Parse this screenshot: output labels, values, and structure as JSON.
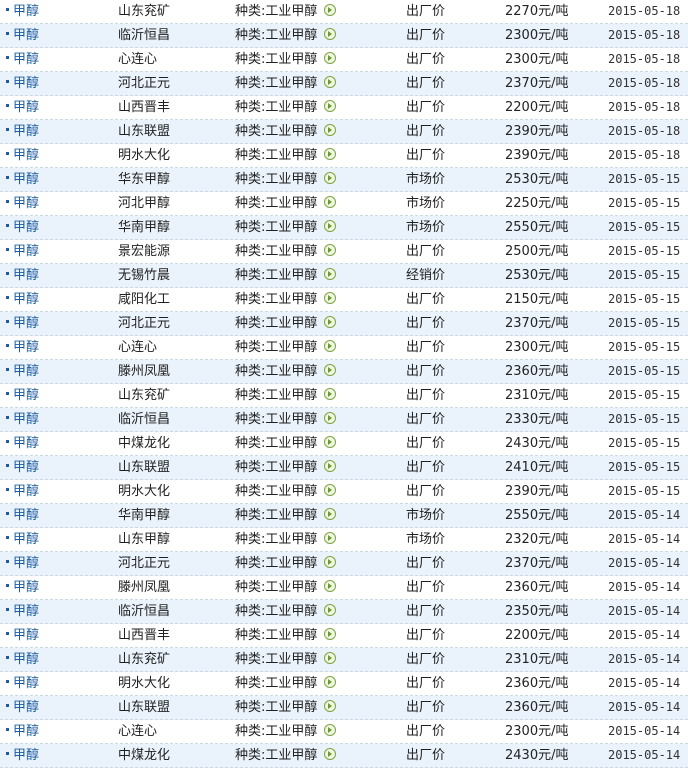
{
  "rows": [
    {
      "product": "甲醇",
      "company": "山东兖矿",
      "category": "种类:工业甲醇",
      "price_type": "出厂价",
      "price": "2270元/吨",
      "date": "2015-05-18"
    },
    {
      "product": "甲醇",
      "company": "临沂恒昌",
      "category": "种类:工业甲醇",
      "price_type": "出厂价",
      "price": "2300元/吨",
      "date": "2015-05-18"
    },
    {
      "product": "甲醇",
      "company": "心连心",
      "category": "种类:工业甲醇",
      "price_type": "出厂价",
      "price": "2300元/吨",
      "date": "2015-05-18"
    },
    {
      "product": "甲醇",
      "company": "河北正元",
      "category": "种类:工业甲醇",
      "price_type": "出厂价",
      "price": "2370元/吨",
      "date": "2015-05-18"
    },
    {
      "product": "甲醇",
      "company": "山西晋丰",
      "category": "种类:工业甲醇",
      "price_type": "出厂价",
      "price": "2200元/吨",
      "date": "2015-05-18"
    },
    {
      "product": "甲醇",
      "company": "山东联盟",
      "category": "种类:工业甲醇",
      "price_type": "出厂价",
      "price": "2390元/吨",
      "date": "2015-05-18"
    },
    {
      "product": "甲醇",
      "company": "明水大化",
      "category": "种类:工业甲醇",
      "price_type": "出厂价",
      "price": "2390元/吨",
      "date": "2015-05-18"
    },
    {
      "product": "甲醇",
      "company": "华东甲醇",
      "category": "种类:工业甲醇",
      "price_type": "市场价",
      "price": "2530元/吨",
      "date": "2015-05-15"
    },
    {
      "product": "甲醇",
      "company": "河北甲醇",
      "category": "种类:工业甲醇",
      "price_type": "市场价",
      "price": "2250元/吨",
      "date": "2015-05-15"
    },
    {
      "product": "甲醇",
      "company": "华南甲醇",
      "category": "种类:工业甲醇",
      "price_type": "市场价",
      "price": "2550元/吨",
      "date": "2015-05-15"
    },
    {
      "product": "甲醇",
      "company": "景宏能源",
      "category": "种类:工业甲醇",
      "price_type": "出厂价",
      "price": "2500元/吨",
      "date": "2015-05-15"
    },
    {
      "product": "甲醇",
      "company": "无锡竹晨",
      "category": "种类:工业甲醇",
      "price_type": "经销价",
      "price": "2530元/吨",
      "date": "2015-05-15"
    },
    {
      "product": "甲醇",
      "company": "咸阳化工",
      "category": "种类:工业甲醇",
      "price_type": "出厂价",
      "price": "2150元/吨",
      "date": "2015-05-15"
    },
    {
      "product": "甲醇",
      "company": "河北正元",
      "category": "种类:工业甲醇",
      "price_type": "出厂价",
      "price": "2370元/吨",
      "date": "2015-05-15"
    },
    {
      "product": "甲醇",
      "company": "心连心",
      "category": "种类:工业甲醇",
      "price_type": "出厂价",
      "price": "2300元/吨",
      "date": "2015-05-15"
    },
    {
      "product": "甲醇",
      "company": "滕州凤凰",
      "category": "种类:工业甲醇",
      "price_type": "出厂价",
      "price": "2360元/吨",
      "date": "2015-05-15"
    },
    {
      "product": "甲醇",
      "company": "山东兖矿",
      "category": "种类:工业甲醇",
      "price_type": "出厂价",
      "price": "2310元/吨",
      "date": "2015-05-15"
    },
    {
      "product": "甲醇",
      "company": "临沂恒昌",
      "category": "种类:工业甲醇",
      "price_type": "出厂价",
      "price": "2330元/吨",
      "date": "2015-05-15"
    },
    {
      "product": "甲醇",
      "company": "中煤龙化",
      "category": "种类:工业甲醇",
      "price_type": "出厂价",
      "price": "2430元/吨",
      "date": "2015-05-15"
    },
    {
      "product": "甲醇",
      "company": "山东联盟",
      "category": "种类:工业甲醇",
      "price_type": "出厂价",
      "price": "2410元/吨",
      "date": "2015-05-15"
    },
    {
      "product": "甲醇",
      "company": "明水大化",
      "category": "种类:工业甲醇",
      "price_type": "出厂价",
      "price": "2390元/吨",
      "date": "2015-05-15"
    },
    {
      "product": "甲醇",
      "company": "华南甲醇",
      "category": "种类:工业甲醇",
      "price_type": "市场价",
      "price": "2550元/吨",
      "date": "2015-05-14"
    },
    {
      "product": "甲醇",
      "company": "山东甲醇",
      "category": "种类:工业甲醇",
      "price_type": "市场价",
      "price": "2320元/吨",
      "date": "2015-05-14"
    },
    {
      "product": "甲醇",
      "company": "河北正元",
      "category": "种类:工业甲醇",
      "price_type": "出厂价",
      "price": "2370元/吨",
      "date": "2015-05-14"
    },
    {
      "product": "甲醇",
      "company": "滕州凤凰",
      "category": "种类:工业甲醇",
      "price_type": "出厂价",
      "price": "2360元/吨",
      "date": "2015-05-14"
    },
    {
      "product": "甲醇",
      "company": "临沂恒昌",
      "category": "种类:工业甲醇",
      "price_type": "出厂价",
      "price": "2350元/吨",
      "date": "2015-05-14"
    },
    {
      "product": "甲醇",
      "company": "山西晋丰",
      "category": "种类:工业甲醇",
      "price_type": "出厂价",
      "price": "2200元/吨",
      "date": "2015-05-14"
    },
    {
      "product": "甲醇",
      "company": "山东兖矿",
      "category": "种类:工业甲醇",
      "price_type": "出厂价",
      "price": "2310元/吨",
      "date": "2015-05-14"
    },
    {
      "product": "甲醇",
      "company": "明水大化",
      "category": "种类:工业甲醇",
      "price_type": "出厂价",
      "price": "2360元/吨",
      "date": "2015-05-14"
    },
    {
      "product": "甲醇",
      "company": "山东联盟",
      "category": "种类:工业甲醇",
      "price_type": "出厂价",
      "price": "2360元/吨",
      "date": "2015-05-14"
    },
    {
      "product": "甲醇",
      "company": "心连心",
      "category": "种类:工业甲醇",
      "price_type": "出厂价",
      "price": "2300元/吨",
      "date": "2015-05-14"
    },
    {
      "product": "甲醇",
      "company": "中煤龙化",
      "category": "种类:工业甲醇",
      "price_type": "出厂价",
      "price": "2430元/吨",
      "date": "2015-05-14"
    }
  ],
  "icons": {
    "row_bullet": "square-bullet-icon",
    "detail_link": "green-circle-arrow-icon"
  },
  "colors": {
    "link": "#1e5c9c",
    "alt_row": "#eaf2fb",
    "separator": "#c9d7e6"
  }
}
